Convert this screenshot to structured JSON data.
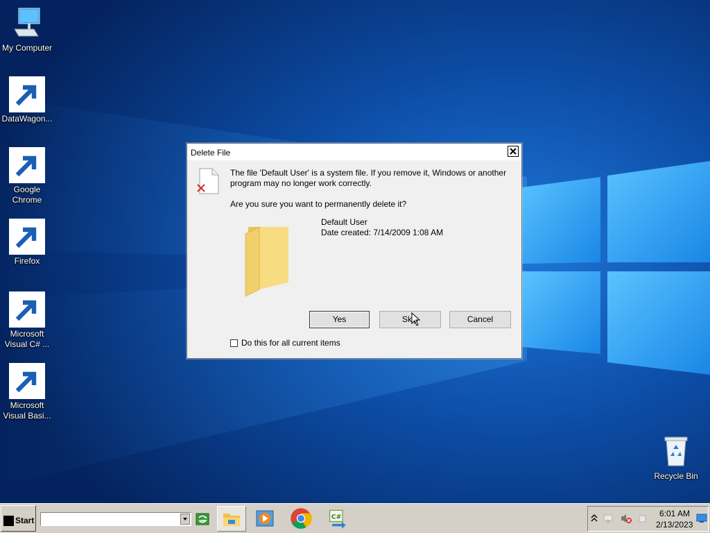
{
  "desktop": {
    "icons": [
      {
        "label": "My Computer",
        "icon": "computer-icon"
      },
      {
        "label": "DataWagon...",
        "icon": "datawagon-icon"
      },
      {
        "label": "Google Chrome",
        "icon": "chrome-icon"
      },
      {
        "label": "Firefox",
        "icon": "firefox-icon"
      },
      {
        "label": "Microsoft Visual C# ...",
        "icon": "visual-csharp-icon"
      },
      {
        "label": "Microsoft Visual Basi...",
        "icon": "visual-basic-icon"
      },
      {
        "label": "Recycle Bin",
        "icon": "recycle-bin-icon"
      }
    ]
  },
  "dialog": {
    "title": "Delete File",
    "message_line1": "The file 'Default User' is a system file. If you remove it, Windows or another",
    "message_line2": "program may no longer work correctly.",
    "question": "Are you sure you want to permanently delete it?",
    "item_name": "Default User",
    "item_date": "Date created: 7/14/2009 1:08 AM",
    "yes_label": "Yes",
    "skip_label": "Skip",
    "cancel_label": "Cancel",
    "checkbox_label": "Do this for all current items",
    "checkbox_checked": false
  },
  "taskbar": {
    "start_label": "Start",
    "address_value": "",
    "apps": [
      "file-explorer-icon",
      "media-player-icon",
      "chrome-icon",
      "visual-csharp-icon"
    ],
    "clock_time": "6:01 AM",
    "clock_date": "2/13/2023"
  },
  "colors": {
    "wallpaper_dark": "#062a66",
    "wallpaper_light": "#4fb4ff",
    "dialog_bg": "#f0f0f0",
    "taskbar_bg": "#d4d0c8"
  }
}
